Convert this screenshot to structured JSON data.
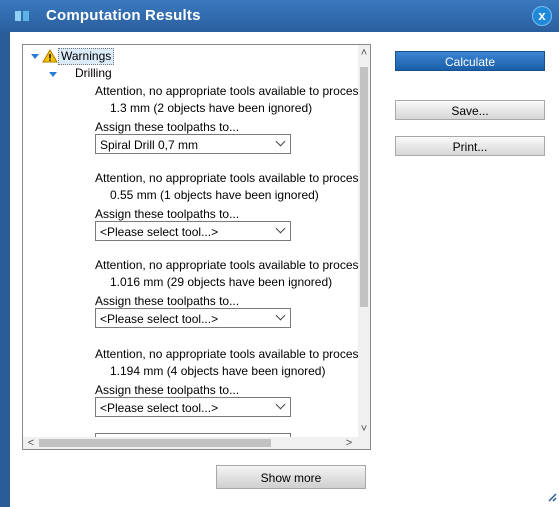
{
  "window": {
    "title": "Computation Results",
    "close_glyph": "x"
  },
  "tree": {
    "root_label": "Warnings",
    "category_label": "Drilling",
    "entries": [
      {
        "line1": "Attention, no appropriate tools available to process",
        "line2": "1.3 mm (2 objects have been ignored)",
        "assign_label": "Assign these toolpaths to...",
        "selected": "Spiral Drill  0,7 mm"
      },
      {
        "line1": "Attention, no appropriate tools available to process",
        "line2": "0.55 mm (1 objects have been ignored)",
        "assign_label": "Assign these toolpaths to...",
        "selected": "<Please select tool...>"
      },
      {
        "line1": "Attention, no appropriate tools available to process",
        "line2": "1.016 mm (29 objects have been ignored)",
        "assign_label": "Assign these toolpaths to...",
        "selected": "<Please select tool...>"
      },
      {
        "line1": "Attention, no appropriate tools available to process",
        "line2": "1.194 mm (4 objects have been ignored)",
        "assign_label": "Assign these toolpaths to...",
        "selected": "<Please select tool...>"
      }
    ]
  },
  "buttons": {
    "calculate": "Calculate",
    "save": "Save...",
    "print": "Print...",
    "show_more": "Show more"
  }
}
